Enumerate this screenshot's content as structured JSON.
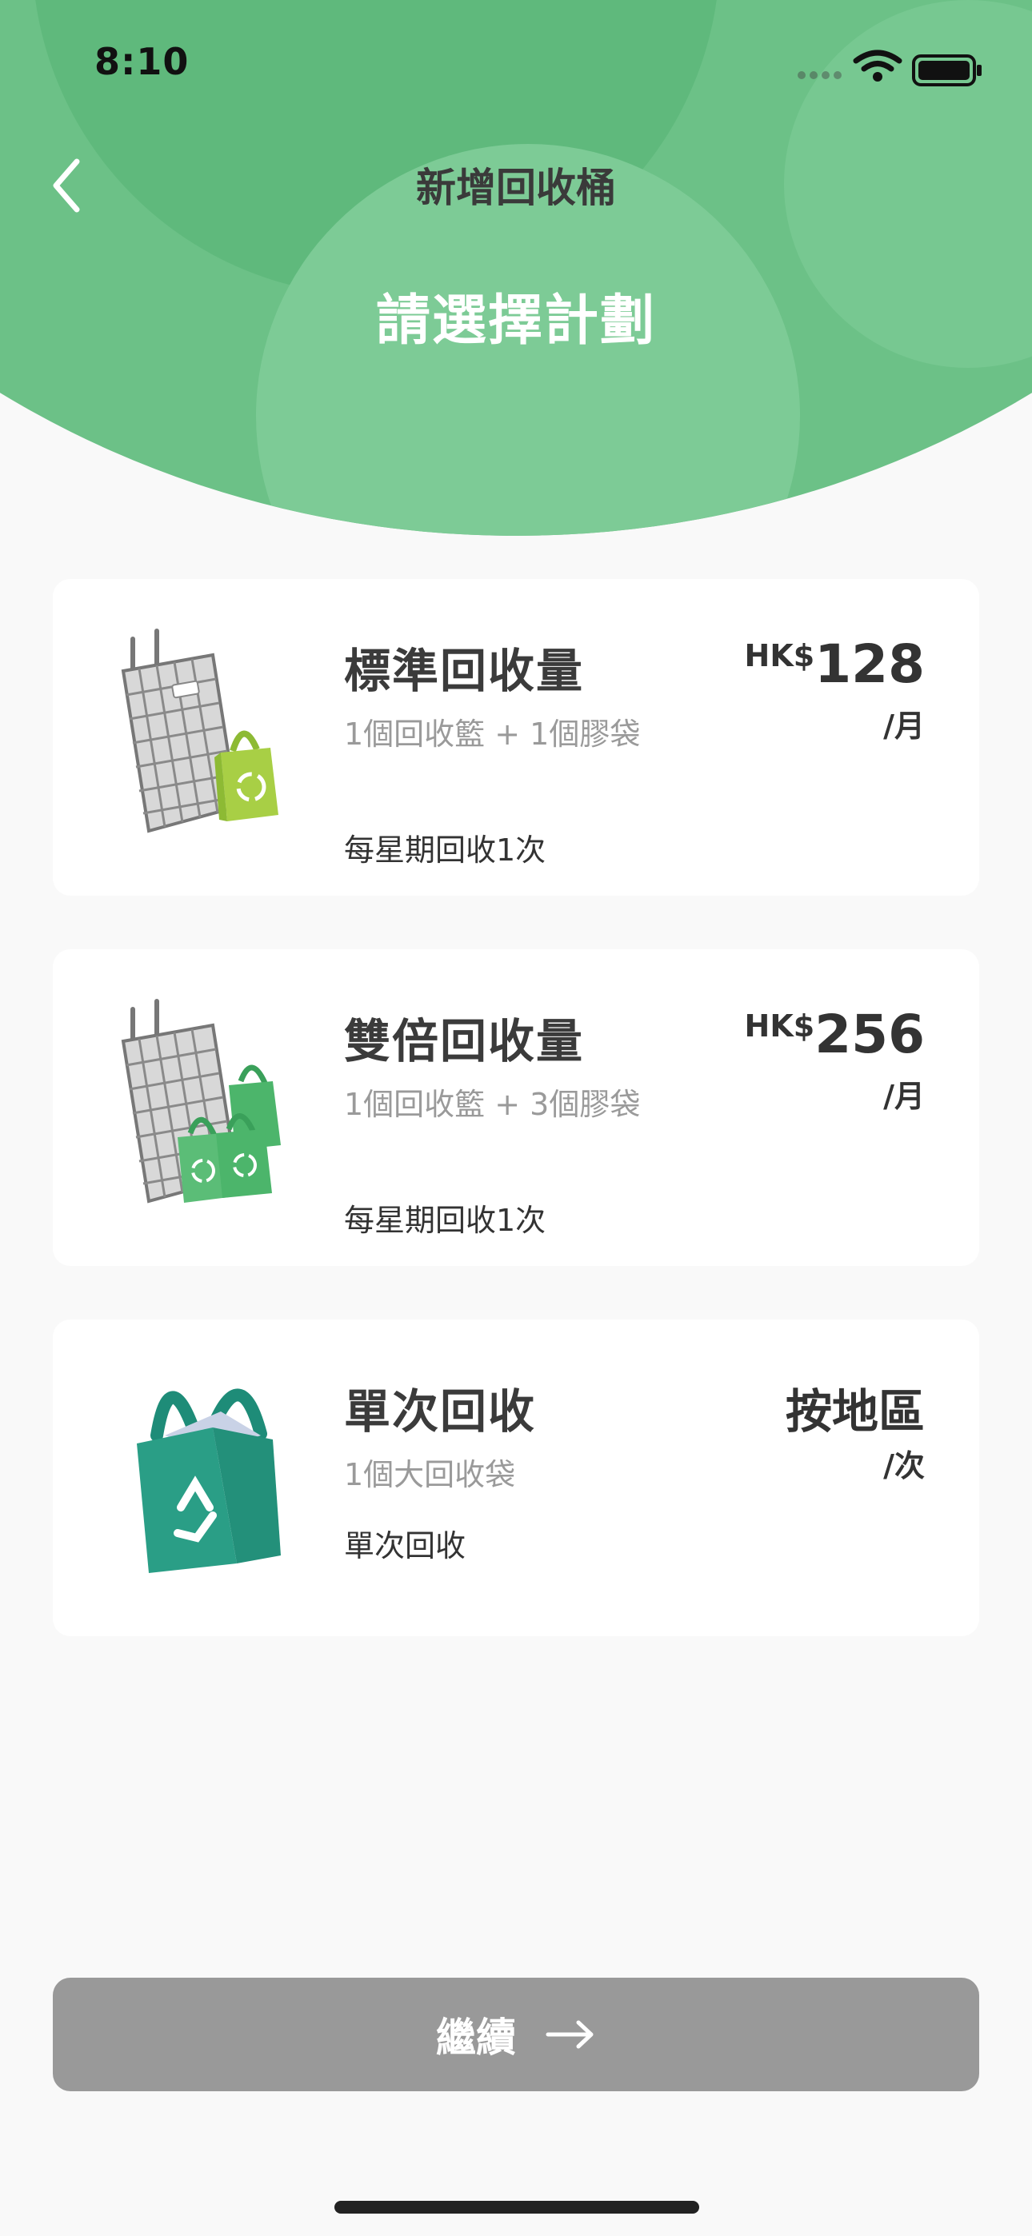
{
  "status": {
    "time": "8:10"
  },
  "nav": {
    "title": "新增回收桶"
  },
  "page": {
    "subtitle": "請選擇計劃"
  },
  "plans": [
    {
      "name": "標準回收量",
      "detail": "1個回收籃 + 1個膠袋",
      "frequency": "每星期回收1次",
      "currency": "HK$",
      "price": "128",
      "unit": "/月",
      "image": "basket-with-one-bag"
    },
    {
      "name": "雙倍回收量",
      "detail": "1個回收籃 + 3個膠袋",
      "frequency": "每星期回收1次",
      "currency": "HK$",
      "price": "256",
      "unit": "/月",
      "image": "basket-with-three-bags"
    },
    {
      "name": "單次回收",
      "detail": "1個大回收袋",
      "frequency": "單次回收",
      "currency": "",
      "price": "按地區",
      "unit": "/次",
      "image": "large-recycle-bag"
    }
  ],
  "footer": {
    "continue_label": "繼續"
  },
  "colors": {
    "header_green": "#6cc187",
    "button_grey": "#999999"
  }
}
